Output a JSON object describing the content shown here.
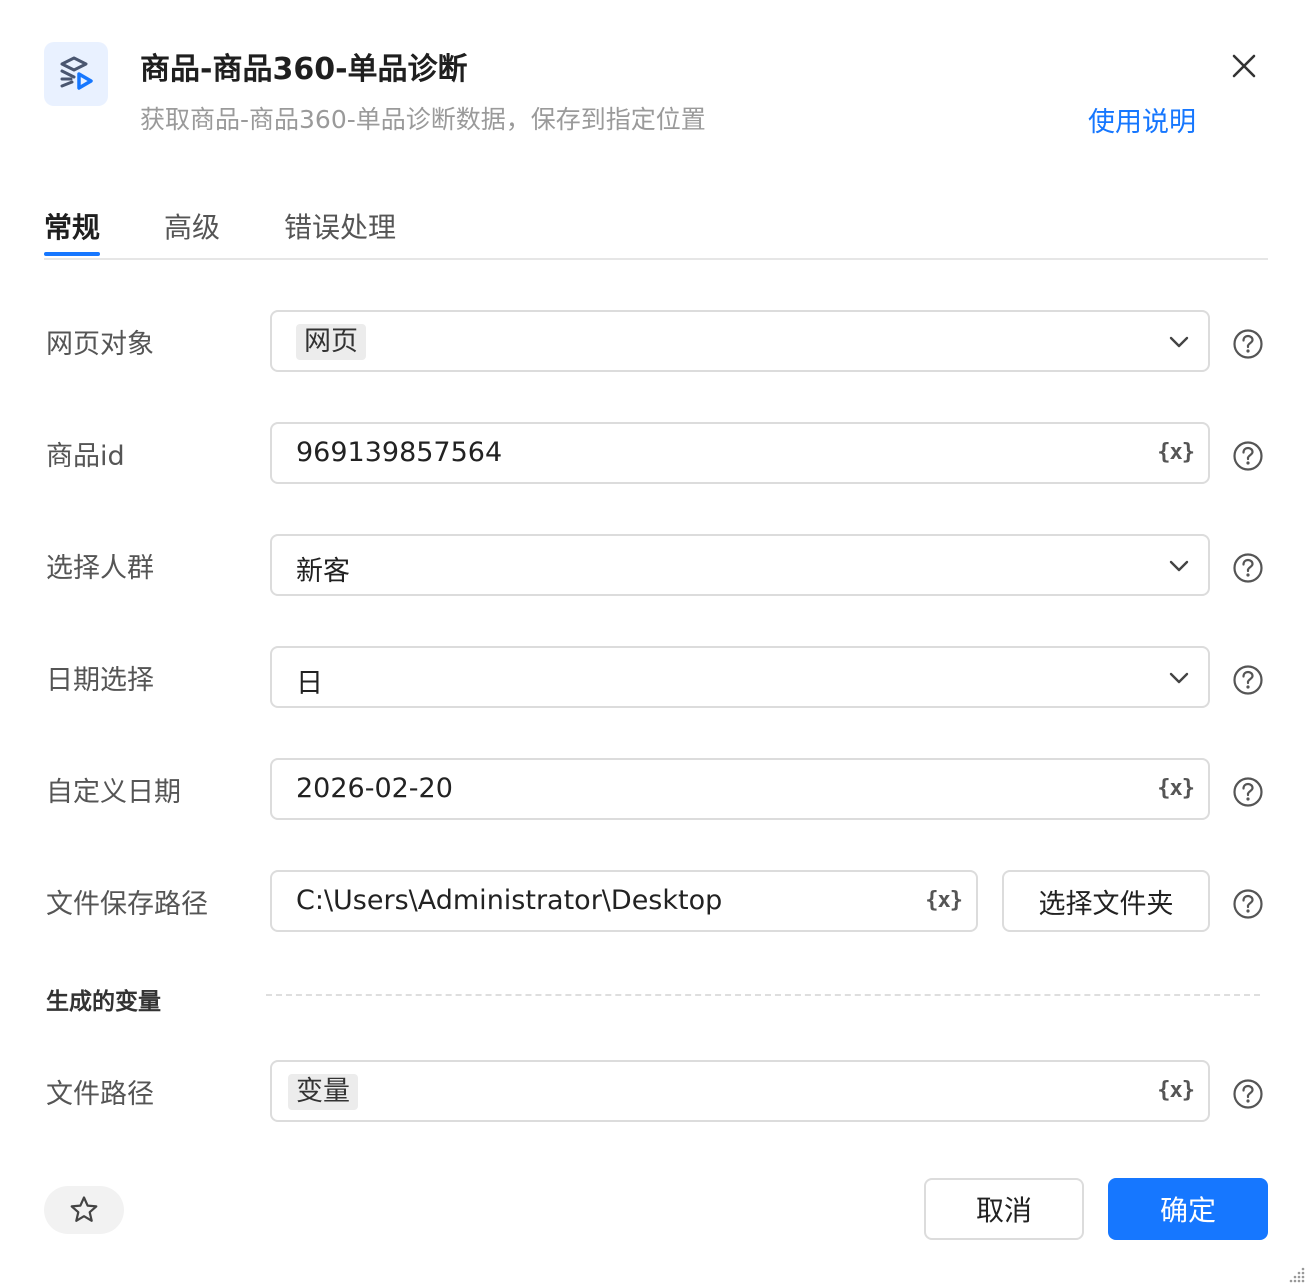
{
  "header": {
    "title": "商品-商品360-单品诊断",
    "subtitle": "获取商品-商品360-单品诊断数据，保存到指定位置",
    "help_link": "使用说明",
    "icon": "product-play-icon"
  },
  "tabs": [
    {
      "label": "常规",
      "active": true
    },
    {
      "label": "高级",
      "active": false
    },
    {
      "label": "错误处理",
      "active": false
    }
  ],
  "form": {
    "web_object": {
      "label": "网页对象",
      "tag": "网页"
    },
    "product_id": {
      "label": "商品id",
      "value": "969139857564"
    },
    "audience": {
      "label": "选择人群",
      "value": "新客"
    },
    "date_type": {
      "label": "日期选择",
      "value": "日"
    },
    "custom_date": {
      "label": "自定义日期",
      "value": "2026-02-20"
    },
    "save_path": {
      "label": "文件保存路径",
      "value": "C:\\Users\\Administrator\\Desktop",
      "button": "选择文件夹"
    }
  },
  "variable_icon_text": "{x}",
  "generated": {
    "section_title": "生成的变量",
    "file_path": {
      "label": "文件路径",
      "tag": "变量"
    }
  },
  "footer": {
    "cancel": "取消",
    "ok": "确定"
  },
  "colors": {
    "accent": "#1677ff",
    "icon_bg": "#e9f1ff"
  }
}
